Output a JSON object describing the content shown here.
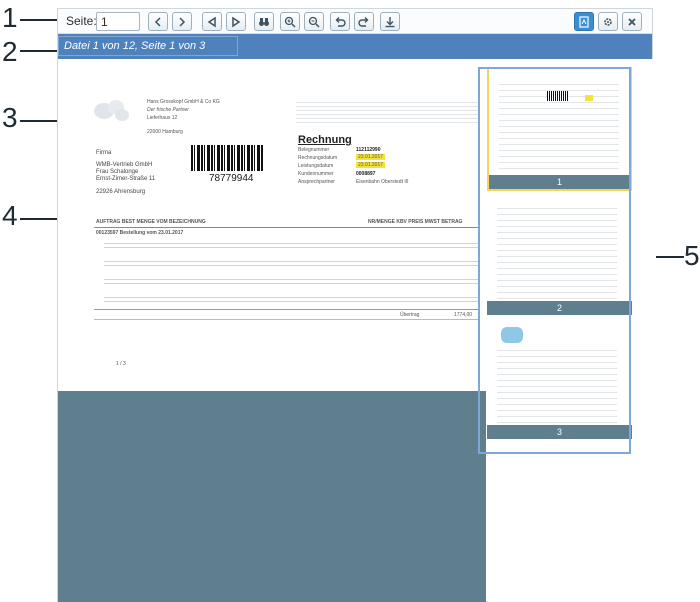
{
  "callouts": {
    "c1": "1",
    "c2": "2",
    "c3": "3",
    "c4": "4",
    "c5": "5"
  },
  "toolbar": {
    "page_label": "Seite:",
    "page_value": "1",
    "icons": [
      "chevron-left",
      "chevron-right",
      "first-page",
      "play-next",
      "binoculars",
      "zoom-in",
      "zoom-out",
      "undo",
      "redo",
      "download",
      "pdf-export",
      "settings",
      "close"
    ]
  },
  "docbar": {
    "status": "Datei 1 von 12, Seite 1 von 3"
  },
  "invoice": {
    "sender_line1": "Hans Grosskopf GmbH & Co KG",
    "sender_line2": "Der frische Partner",
    "sender_line3": "Lieferhaus 12",
    "sender_line4": "22000 Hamburg",
    "recipient_firm": "Firma",
    "recipient_name": "WMB-Vertrieb GmbH",
    "recipient_contact": "Frau Schalonge",
    "recipient_street": "Ernst-Zimer-Straße 11",
    "recipient_city": "22926 Ahrensburg",
    "barcode_number": "78779944",
    "title": "Rechnung",
    "belegnummer_label": "Belegnummer",
    "belegnummer_value": "112112990",
    "rechnungsdatum_label": "Rechnungsdatum",
    "rechnungsdatum_value": "23.01.2017",
    "leistungsdatum_label": "Leistungsdatum",
    "leistungsdatum_value": "23.01.2017",
    "kundennummer_label": "Kundennummer",
    "kundennummer_value": "0008897",
    "ansprechpartner_label": "Ansprechpartner",
    "ansprechpartner_value": "Eisenbahn Oberstedt III",
    "table_header": "AUFTRAG  BEST  MENGE  VOM  BEZEICHNUNG",
    "table_header_right": "NR/MENGE  KBV  PREIS  MWST  BETRAG",
    "order_line": "00123597  Bestellung vom 23.01.2017",
    "footer_sum_label": "Übertrag",
    "footer_sum_value": "1774,00",
    "page_marker": "1 / 3"
  },
  "thumbnails": [
    {
      "label": "1"
    },
    {
      "label": "2"
    },
    {
      "label": "3"
    }
  ],
  "colors": {
    "docbar": "#4f81bc",
    "gray_area": "#5f7f8e",
    "thumb_selected": "#f3d55d",
    "highlight": "#f2e33a"
  }
}
